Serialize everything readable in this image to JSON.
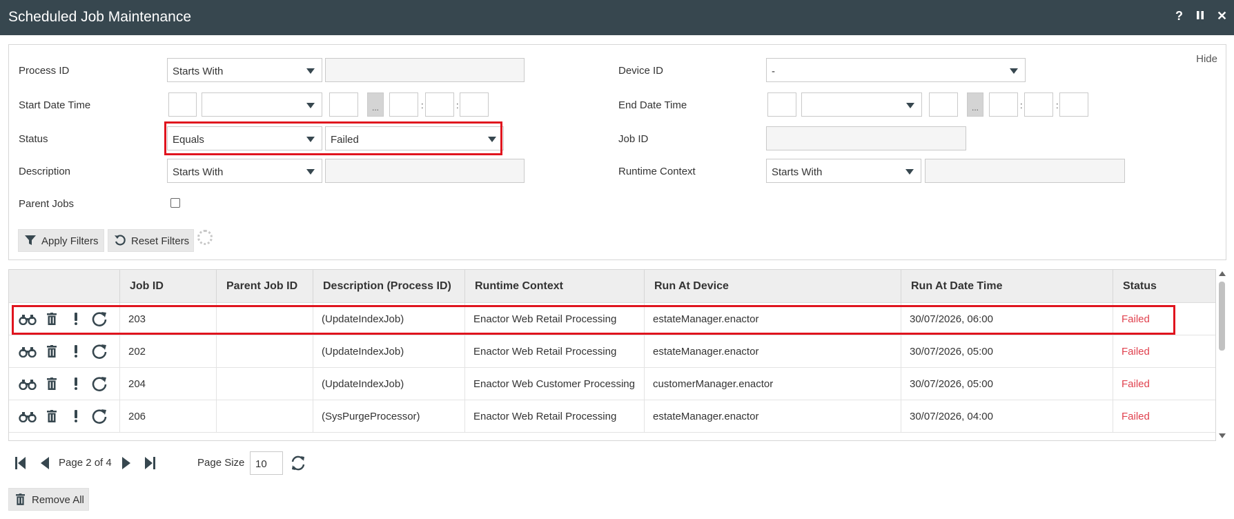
{
  "window": {
    "title": "Scheduled Job Maintenance",
    "help_label": "?",
    "pause_label": "II",
    "close_label": "✕"
  },
  "filters": {
    "hide_label": "Hide",
    "process_id": {
      "label": "Process ID",
      "operator": "Starts With",
      "value": ""
    },
    "device_id": {
      "label": "Device ID",
      "value": "-"
    },
    "start_date_time": {
      "label": "Start Date Time",
      "dots": "..."
    },
    "end_date_time": {
      "label": "End Date Time",
      "dots": "..."
    },
    "status": {
      "label": "Status",
      "operator": "Equals",
      "value": "Failed"
    },
    "job_id": {
      "label": "Job ID",
      "value": ""
    },
    "description": {
      "label": "Description",
      "operator": "Starts With",
      "value": ""
    },
    "runtime_context": {
      "label": "Runtime Context",
      "operator": "Starts With",
      "value": ""
    },
    "parent_jobs": {
      "label": "Parent Jobs",
      "checked": false
    },
    "apply_label": "Apply Filters",
    "reset_label": "Reset Filters"
  },
  "grid": {
    "columns": [
      "Job ID",
      "Parent Job ID",
      "Description (Process ID)",
      "Runtime Context",
      "Run At Device",
      "Run At Date Time",
      "Status"
    ],
    "rows": [
      {
        "job_id": "203",
        "parent_job_id": "",
        "description": "(UpdateIndexJob)",
        "runtime_context": "Enactor Web Retail Processing",
        "device": "estateManager.enactor",
        "datetime": "30/07/2026, 06:00",
        "status": "Failed"
      },
      {
        "job_id": "202",
        "parent_job_id": "",
        "description": "(UpdateIndexJob)",
        "runtime_context": "Enactor Web Retail Processing",
        "device": "estateManager.enactor",
        "datetime": "30/07/2026, 05:00",
        "status": "Failed"
      },
      {
        "job_id": "204",
        "parent_job_id": "",
        "description": "(UpdateIndexJob)",
        "runtime_context": "Enactor Web Customer Processing",
        "device": "customerManager.enactor",
        "datetime": "30/07/2026, 05:00",
        "status": "Failed"
      },
      {
        "job_id": "206",
        "parent_job_id": "",
        "description": "(SysPurgeProcessor)",
        "runtime_context": "Enactor Web Retail Processing",
        "device": "estateManager.enactor",
        "datetime": "30/07/2026, 04:00",
        "status": "Failed"
      }
    ],
    "row_actions": [
      "binoculars-icon",
      "trash-icon",
      "exclamation-icon",
      "refresh-icon"
    ]
  },
  "pager": {
    "page_text": "Page 2 of 4",
    "page_size_label": "Page Size",
    "page_size": "10"
  },
  "remove_all_label": "Remove All",
  "colors": {
    "titlebar": "#37474f",
    "status_failed": "#e0414e",
    "highlight": "#e0141e"
  }
}
